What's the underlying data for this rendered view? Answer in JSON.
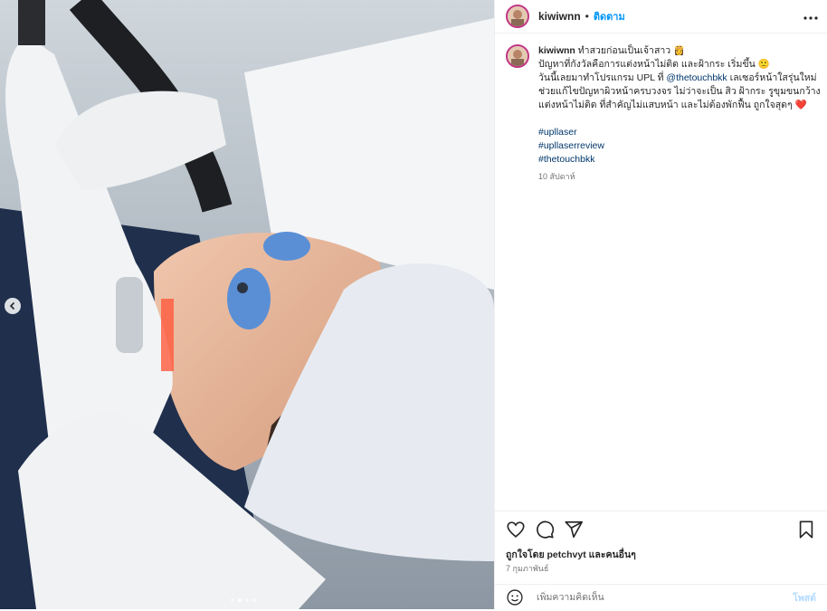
{
  "post": {
    "username": "kiwiwnn",
    "separator": "•",
    "follow_label": "ติดตาม",
    "more_icon": "more-icon"
  },
  "caption": {
    "username": "kiwiwnn",
    "line1": "ทำสวยก่อนเป็นเจ้าสาว 👸",
    "line2": "ปัญหาที่กังวัลคือการแต่งหน้าไม่ติด และฝ้ากระ เริ่มขึ้น 🙁",
    "line3_a": "วันนี้เลยมาทำโปรแกรม UPL ที่ ",
    "line3_mention": "@thetouchbkk",
    "line3_b": " เลเซอร์หน้าใสรุ่นใหม่",
    "line4": "ช่วยแก้ไขปัญหาผิวหน้าครบวงจร ไม่ว่าจะเป็น สิว ฝ้ากระ รูขุมขนกว้าง",
    "line5": "แต่งหน้าไม่ติด ที่สำคัญไม่แสบหน้า และไม่ต้องพักฟื้น ถูกใจสุดๆ ❤️",
    "tags": [
      "#upllaser",
      "#upllaserreview",
      "#thetouchbkk"
    ],
    "time": "10 สัปดาห์"
  },
  "likes": {
    "text": "ถูกใจโดย petchvyt และคนอื่นๆ"
  },
  "date": "7 กุมภาพันธ์",
  "comment": {
    "placeholder": "เพิ่มความคิดเห็น",
    "post_label": "โพสต์"
  },
  "carousel": {
    "dots": 4,
    "active_index": 1
  },
  "colors": {
    "accent": "#0095f6",
    "ring": "#c13584"
  }
}
